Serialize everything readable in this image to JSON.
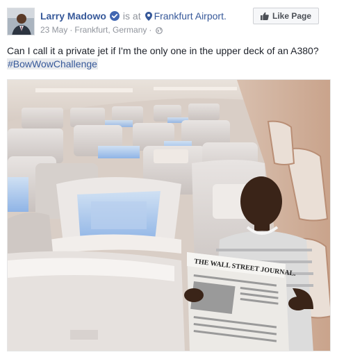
{
  "post": {
    "author": "Larry Madowo",
    "is_at": "is at",
    "location": "Frankfurt Airport.",
    "date": "23 May",
    "place": "Frankfurt, Germany",
    "separator": "·",
    "like_button_label": "Like Page",
    "text": "Can I call it a private jet if I'm the only one in the upper deck of an A380?",
    "hashtag": "#BowWowChallenge",
    "newspaper_masthead": "THE WALL STREET JOURNAL."
  },
  "icons": {
    "verified": "verified-badge-icon",
    "location": "map-pin-icon",
    "privacy": "globe-icon",
    "like": "thumbs-up-icon"
  },
  "colors": {
    "link": "#365899",
    "meta": "#90949c",
    "verified": "#4267b2"
  }
}
